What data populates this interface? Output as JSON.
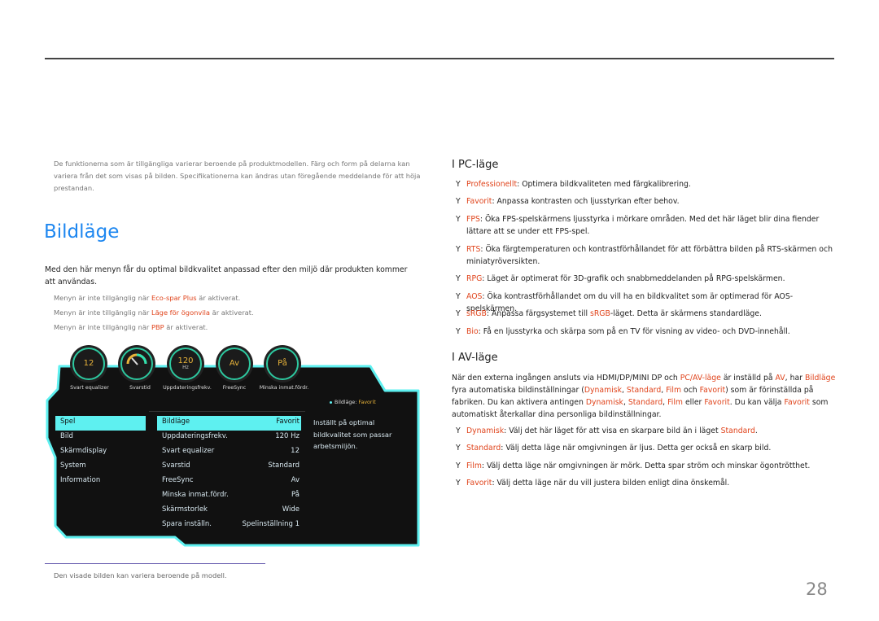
{
  "top_note": "De funktionerna som är tillgängliga varierar beroende på produktmodellen. Färg och form på delarna kan variera från det som visas på bilden. Specifikationerna kan ändras utan föregående meddelande för att höja prestandan.",
  "title": "Bildläge",
  "intro": "Med den här menyn får du optimal bildkvalitet anpassad efter den miljö där produkten kommer att användas.",
  "notes": [
    [
      {
        "t": "Menyn är inte tillgänglig när "
      },
      {
        "t": "Eco-spar Plus",
        "hl": true
      },
      {
        "t": " är aktiverat."
      }
    ],
    [
      {
        "t": "Menyn är inte tillgänglig när "
      },
      {
        "t": "Läge för ögonvila",
        "hl": true
      },
      {
        "t": " är aktiverat."
      }
    ],
    [
      {
        "t": "Menyn är inte tillgänglig när "
      },
      {
        "t": "PBP",
        "hl": true
      },
      {
        "t": " är aktiverat."
      }
    ]
  ],
  "osd": {
    "gauges": [
      {
        "value": "12",
        "label": "Svart equalizer"
      },
      {
        "value": "",
        "label": "Svarstid"
      },
      {
        "value": "120",
        "unit": "Hz",
        "label": "Uppdateringsfrekv."
      },
      {
        "value": "Av",
        "label": "FreeSync"
      },
      {
        "value": "På",
        "label": "Minska inmat.fördr."
      }
    ],
    "status_label": "Bildläge: ",
    "status_value": "Favorit",
    "left_menu": [
      "Spel",
      "Bild",
      "Skärmdisplay",
      "System",
      "Information"
    ],
    "left_selected": "Spel",
    "settings": [
      {
        "label": "Bildläge",
        "value": "Favorit"
      },
      {
        "label": "Uppdateringsfrekv.",
        "value": "120 Hz"
      },
      {
        "label": "Svart equalizer",
        "value": "12"
      },
      {
        "label": "Svarstid",
        "value": "Standard"
      },
      {
        "label": "FreeSync",
        "value": "Av"
      },
      {
        "label": "Minska inmat.fördr.",
        "value": "På"
      },
      {
        "label": "Skärmstorlek",
        "value": "Wide"
      },
      {
        "label": "Spara inställn.",
        "value": "Spelinställning 1"
      }
    ],
    "description": "Inställt på optimal bildkvalitet som passar arbetsmiljön.",
    "colors": {
      "accent": "#5ef0f0",
      "value": "#e8b33a",
      "ring": "#2dc9a0"
    }
  },
  "footnote": "Den visade bilden kan variera beroende på modell.",
  "page_number": "28",
  "pc": {
    "heading": "I PC-läge",
    "bullet": "Y",
    "items": [
      [
        {
          "t": "Professionellt",
          "hl": true
        },
        {
          "t": ": Optimera bildkvaliteten med färgkalibrering."
        }
      ],
      [
        {
          "t": "Favorit",
          "hl": true
        },
        {
          "t": ": Anpassa kontrasten och ljusstyrkan efter behov."
        }
      ],
      [
        {
          "t": "FPS",
          "hl": true
        },
        {
          "t": ": Öka FPS-spelskärmens ljusstyrka i mörkare områden. Med det här läget blir dina fiender lättare att se under ett FPS-spel."
        }
      ],
      [
        {
          "t": "RTS",
          "hl": true
        },
        {
          "t": ": Öka färgtemperaturen och kontrastförhållandet för att förbättra bilden på RTS-skärmen och miniatyröversikten."
        }
      ],
      [
        {
          "t": "RPG",
          "hl": true
        },
        {
          "t": ": Läget är optimerat för 3D-grafik och snabbmeddelanden på RPG-spelskärmen."
        }
      ],
      [
        {
          "t": "AOS",
          "hl": true
        },
        {
          "t": ": Öka kontrastförhållandet om du vill ha en bildkvalitet som är optimerad för AOS-spelskärmen."
        }
      ],
      [
        {
          "t": "sRGB",
          "hl": true
        },
        {
          "t": ": Anpassa färgsystemet till "
        },
        {
          "t": "sRGB",
          "hl": true
        },
        {
          "t": "-läget. Detta är skärmens standardläge."
        }
      ],
      [
        {
          "t": "Bio",
          "hl": true
        },
        {
          "t": ": Få en ljusstyrka och skärpa som på en TV för visning av video- och DVD-innehåll."
        }
      ]
    ]
  },
  "av": {
    "heading": "I AV-läge",
    "paragraph": [
      {
        "t": "När den externa ingången ansluts via HDMI/DP/MINI DP och "
      },
      {
        "t": "PC/AV-läge",
        "hl": true
      },
      {
        "t": " är inställd på "
      },
      {
        "t": "AV",
        "hl": true
      },
      {
        "t": ", har "
      },
      {
        "t": "Bildläge",
        "hl": true
      },
      {
        "t": " fyra automatiska bildinställningar ("
      },
      {
        "t": "Dynamisk",
        "hl": true
      },
      {
        "t": ", "
      },
      {
        "t": "Standard",
        "hl": true
      },
      {
        "t": ", "
      },
      {
        "t": "Film",
        "hl": true
      },
      {
        "t": " och "
      },
      {
        "t": "Favorit",
        "hl": true
      },
      {
        "t": ") som är förinställda på fabriken. Du kan aktivera antingen "
      },
      {
        "t": "Dynamisk",
        "hl": true
      },
      {
        "t": ", "
      },
      {
        "t": "Standard",
        "hl": true
      },
      {
        "t": ", "
      },
      {
        "t": "Film",
        "hl": true
      },
      {
        "t": " eller "
      },
      {
        "t": "Favorit",
        "hl": true
      },
      {
        "t": ". Du kan välja "
      },
      {
        "t": "Favorit",
        "hl": true
      },
      {
        "t": " som automatiskt återkallar dina personliga bildinställningar."
      }
    ],
    "bullet": "Y",
    "items": [
      [
        {
          "t": "Dynamisk",
          "hl": true
        },
        {
          "t": ": Välj det här läget för att visa en skarpare bild än i läget "
        },
        {
          "t": "Standard",
          "hl": true
        },
        {
          "t": "."
        }
      ],
      [
        {
          "t": "Standard",
          "hl": true
        },
        {
          "t": ": Välj detta läge när omgivningen är ljus. Detta ger också en skarp bild."
        }
      ],
      [
        {
          "t": "Film",
          "hl": true
        },
        {
          "t": ": Välj detta läge när omgivningen är mörk. Detta spar ström och minskar ögontrötthet."
        }
      ],
      [
        {
          "t": "Favorit",
          "hl": true
        },
        {
          "t": ": Välj detta läge när du vill justera bilden enligt dina önskemål."
        }
      ]
    ]
  },
  "colors": {
    "title": "#1e87f0",
    "highlight": "#e0441c"
  }
}
